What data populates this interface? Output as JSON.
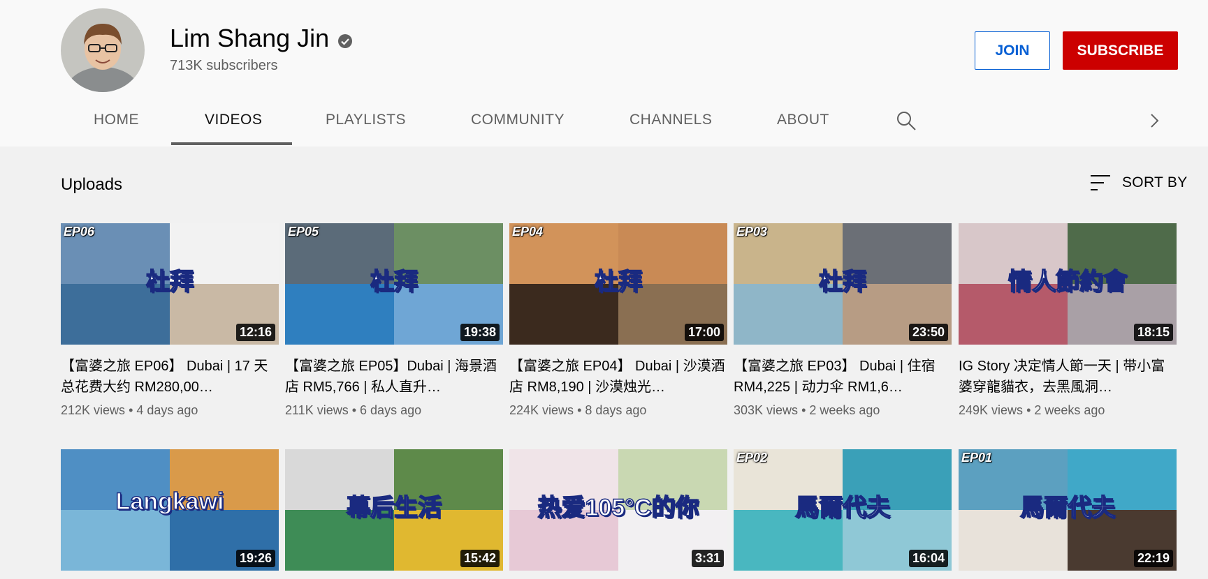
{
  "channel": {
    "name": "Lim Shang Jin",
    "subscribers": "713K subscribers",
    "join_label": "JOIN",
    "subscribe_label": "SUBSCRIBE",
    "subscribe_color": "#cc0000",
    "join_color": "#065fd4"
  },
  "tabs": [
    {
      "label": "HOME"
    },
    {
      "label": "VIDEOS",
      "active": true
    },
    {
      "label": "PLAYLISTS"
    },
    {
      "label": "COMMUNITY"
    },
    {
      "label": "CHANNELS"
    },
    {
      "label": "ABOUT"
    }
  ],
  "section": {
    "title": "Uploads",
    "sort_label": "SORT BY"
  },
  "videos": [
    {
      "title": "【富婆之旅 EP06】 Dubai | 17 天总花费大约 RM280,00…",
      "views": "212K views",
      "age": "4 days ago",
      "duration": "12:16",
      "tag": "EP06",
      "overlay": "杜拜",
      "colors": [
        "#6a8fb5",
        "#f2f2f2",
        "#3d6e9a",
        "#c9b9a5"
      ]
    },
    {
      "title": "【富婆之旅 EP05】Dubai | 海景酒店 RM5,766 | 私人直升…",
      "views": "211K views",
      "age": "6 days ago",
      "duration": "19:38",
      "tag": "EP05",
      "overlay": "杜拜",
      "colors": [
        "#5b6b79",
        "#6c8f63",
        "#2f7fbf",
        "#6fa6d5"
      ]
    },
    {
      "title": "【富婆之旅 EP04】 Dubai | 沙漠酒店 RM8,190 | 沙漠烛光…",
      "views": "224K views",
      "age": "8 days ago",
      "duration": "17:00",
      "tag": "EP04",
      "overlay": "杜拜",
      "colors": [
        "#d2935a",
        "#c98a55",
        "#3b2a1e",
        "#8a6f52"
      ]
    },
    {
      "title": "【富婆之旅 EP03】 Dubai | 住宿 RM4,225 | 动力伞 RM1,6…",
      "views": "303K views",
      "age": "2 weeks ago",
      "duration": "23:50",
      "tag": "EP03",
      "overlay": "杜拜",
      "colors": [
        "#c9b48b",
        "#6b6f76",
        "#8fb6c8",
        "#b79c84"
      ]
    },
    {
      "title": "IG Story 决定情人節一天 | 带小富婆穿龍貓衣，去黑風洞…",
      "views": "249K views",
      "age": "2 weeks ago",
      "duration": "18:15",
      "tag": "",
      "overlay": "情人節約會",
      "colors": [
        "#d8c7c9",
        "#4f6b4a",
        "#b55a6a",
        "#a9a0a6"
      ]
    },
    {
      "duration": "19:26",
      "tag": "",
      "overlay": "Langkawi",
      "colors": [
        "#4f8fc4",
        "#d99a4a",
        "#7ab6d8",
        "#2f6fa8"
      ]
    },
    {
      "duration": "15:42",
      "tag": "",
      "overlay": "幕后生活",
      "colors": [
        "#d9d9d9",
        "#5e8a4a",
        "#3e8c56",
        "#e0b830"
      ]
    },
    {
      "duration": "3:31",
      "tag": "",
      "overlay": "热爱105°C的你",
      "colors": [
        "#f0e4e8",
        "#c9d8b2",
        "#e7c9d6",
        "#f2f0f2"
      ]
    },
    {
      "duration": "16:04",
      "tag": "EP02",
      "overlay": "馬爾代夫",
      "colors": [
        "#e9e4d8",
        "#3aa0b8",
        "#49b7c0",
        "#8fc8d6"
      ]
    },
    {
      "duration": "22:19",
      "tag": "EP01",
      "overlay": "馬爾代夫",
      "colors": [
        "#5ca0c0",
        "#40a8c8",
        "#e8e2da",
        "#4a3a30"
      ]
    }
  ]
}
